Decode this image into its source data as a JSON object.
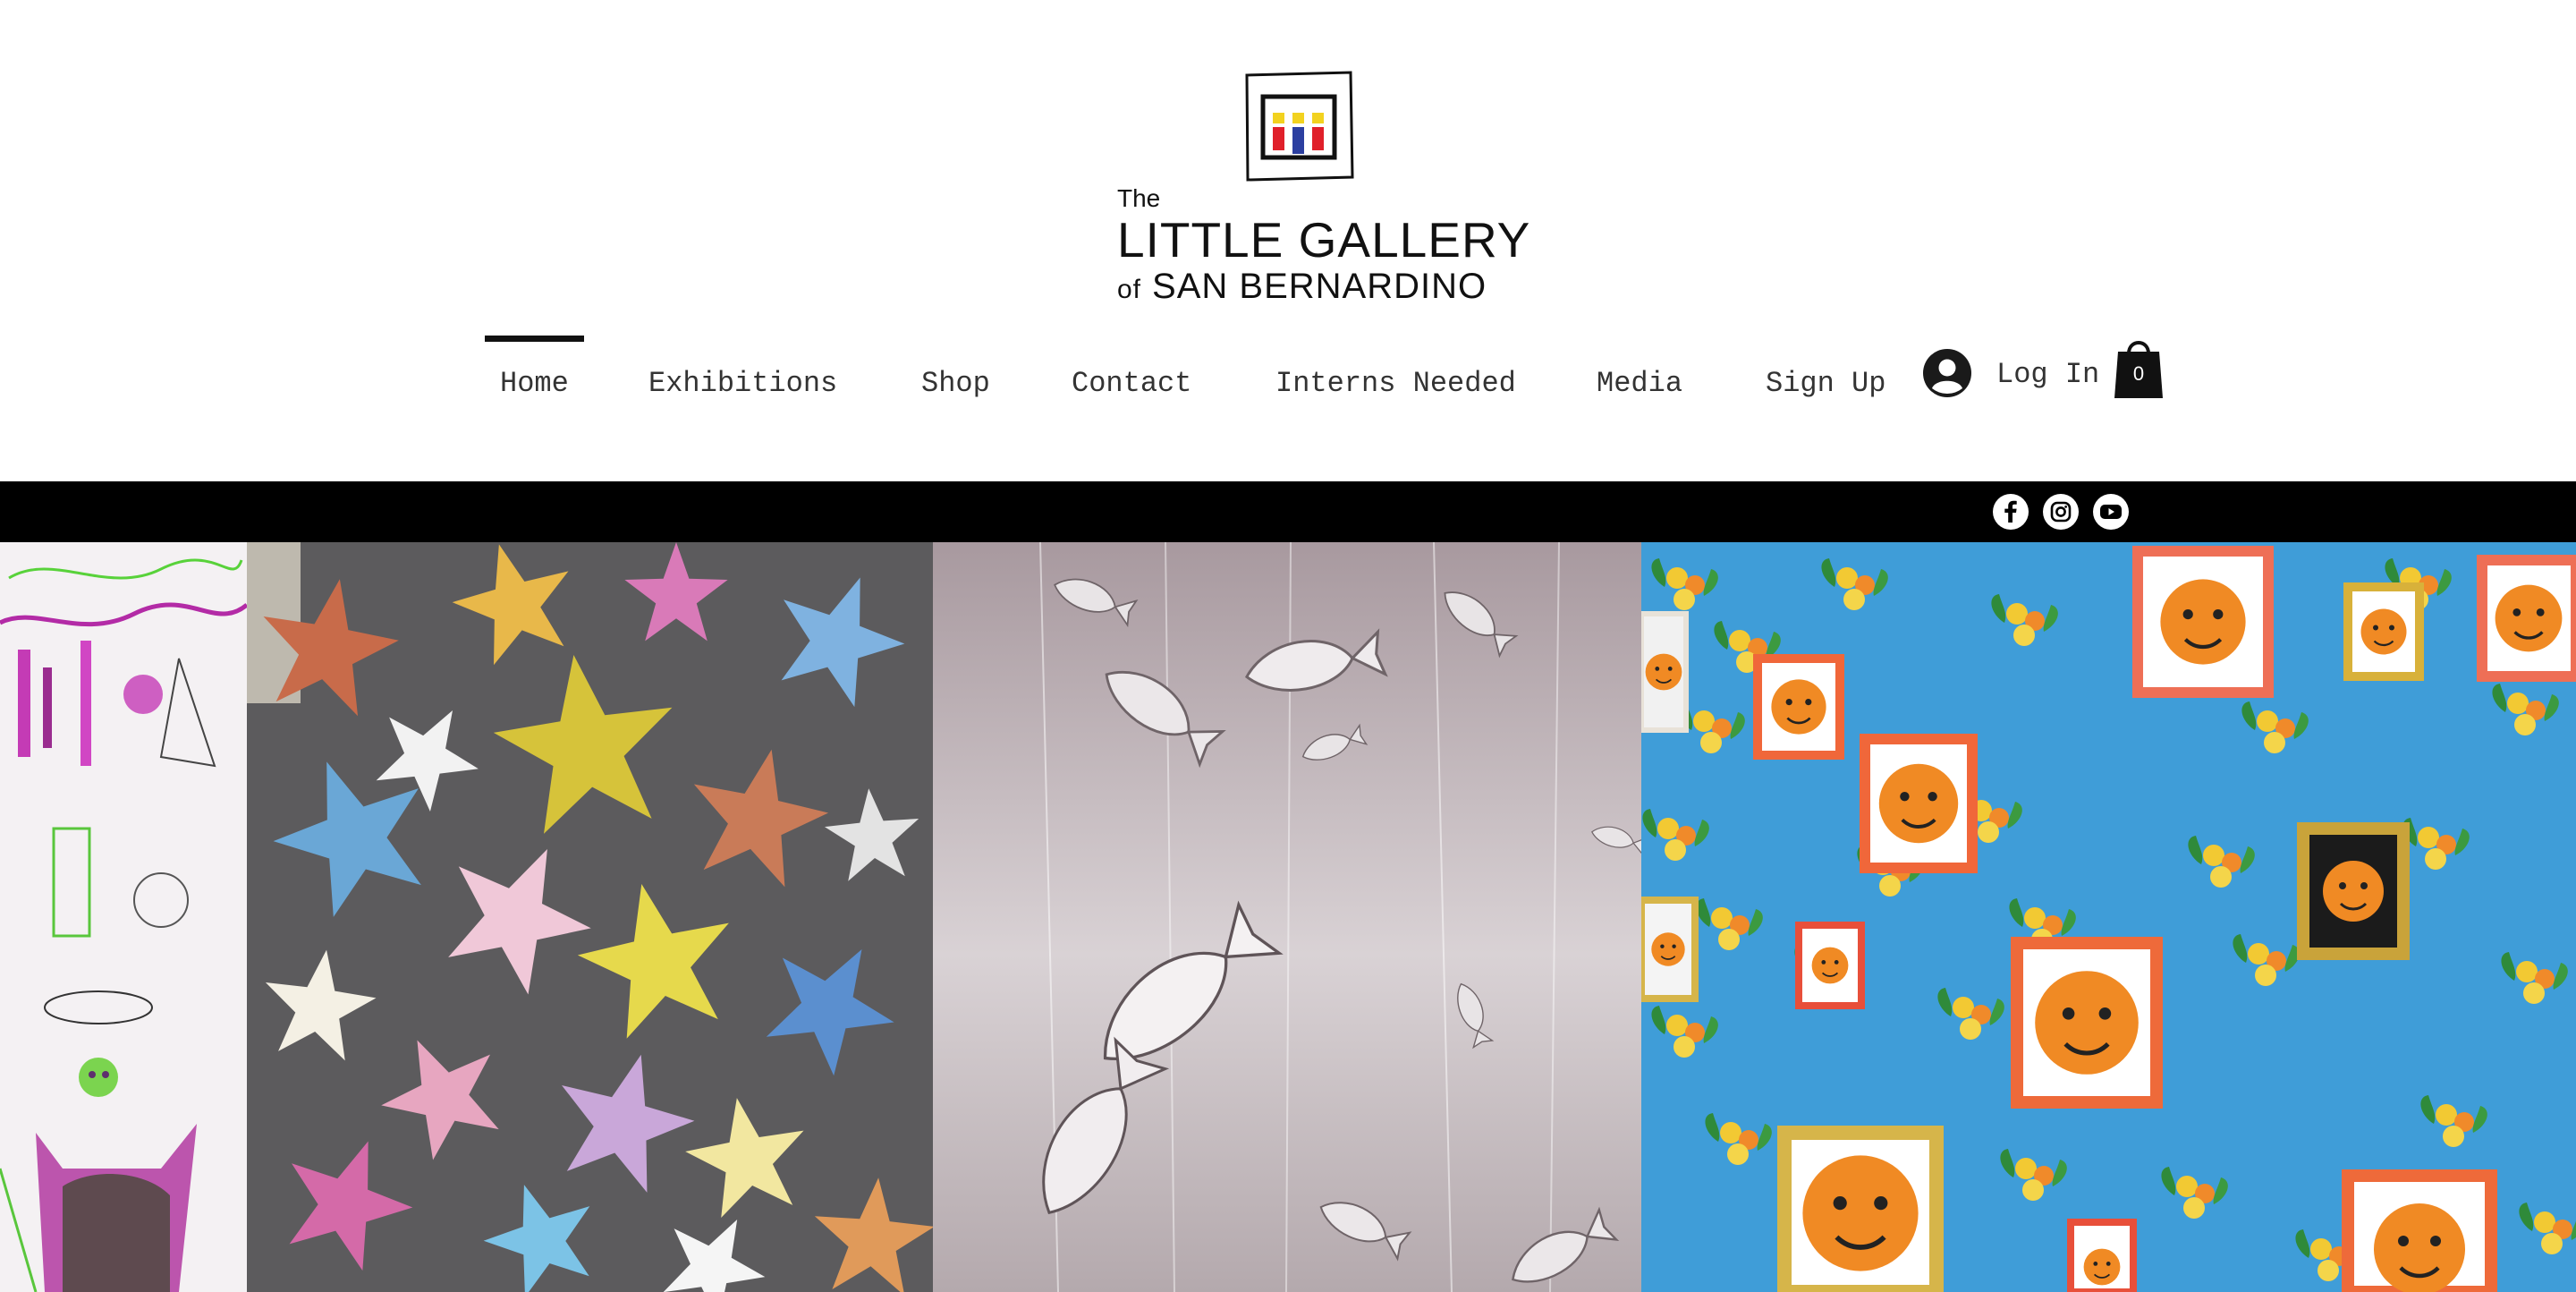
{
  "logo": {
    "the": "The",
    "line1": "LITTLE GALLERY",
    "of": "of",
    "line2": "SAN BERNARDINO",
    "icon": "gallery-logo-icon",
    "colors": {
      "yellow": "#f2d21f",
      "red": "#e0202a",
      "blue": "#2c3fa0"
    }
  },
  "nav": {
    "items": [
      {
        "label": "Home",
        "active": true
      },
      {
        "label": "Exhibitions"
      },
      {
        "label": "Shop"
      },
      {
        "label": "Contact"
      },
      {
        "label": "Interns Needed"
      },
      {
        "label": "Media"
      },
      {
        "label": "Sign Up"
      }
    ],
    "login": {
      "label": "Log In",
      "icon": "account-avatar-icon"
    },
    "cart": {
      "count": "0",
      "icon": "shopping-bag-icon"
    }
  },
  "social": [
    {
      "name": "facebook",
      "icon": "facebook-icon"
    },
    {
      "name": "instagram",
      "icon": "instagram-icon"
    },
    {
      "name": "youtube",
      "icon": "youtube-icon"
    }
  ],
  "colors": {
    "strip": "#000000",
    "gallery_sky": "#3f9dd8",
    "stars_bg": "#5a5a5a",
    "glass_bg": "#bdb0b5"
  },
  "gallery": [
    {
      "name": "sketch-artwork-image"
    },
    {
      "name": "paper-stars-image"
    },
    {
      "name": "glass-fish-image"
    },
    {
      "name": "framed-faces-image"
    }
  ]
}
